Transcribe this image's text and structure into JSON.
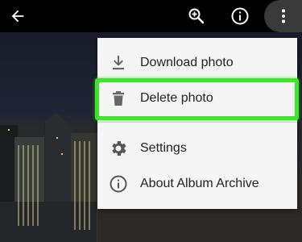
{
  "toolbar": {
    "back_icon": "arrow-back-icon",
    "zoom_icon": "zoom-in-icon",
    "info_icon": "info-icon",
    "more_icon": "more-vert-icon"
  },
  "menu": {
    "items": [
      {
        "label": "Download photo",
        "icon": "download-icon"
      },
      {
        "label": "Delete photo",
        "icon": "trash-icon"
      },
      {
        "label": "Settings",
        "icon": "gear-icon"
      },
      {
        "label": "About Album Archive",
        "icon": "info-icon"
      }
    ]
  },
  "colors": {
    "toolbar_bg": "#000000",
    "menu_bg": "#f5f5f5",
    "highlight": "#3ee52a",
    "menu_text": "#222222",
    "icon_gray": "#666666"
  }
}
